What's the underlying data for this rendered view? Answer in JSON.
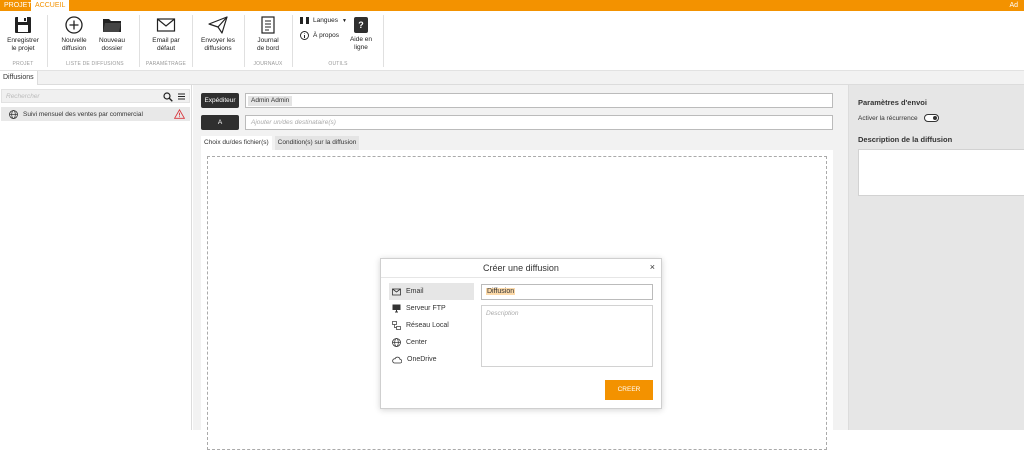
{
  "tabs": {
    "projet": "PROJET",
    "accueil": "ACCUEIL",
    "user": "Ad"
  },
  "ribbon": {
    "save": "Enregistrer\nle projet",
    "new_diffusion": "Nouvelle\ndiffusion",
    "new_folder": "Nouveau\ndossier",
    "email_default": "Email par\ndéfaut",
    "send": "Envoyer les\ndiffusions",
    "journal": "Journal\nde bord",
    "langues": "Langues",
    "apropos": "À propos",
    "help": "Aide en\nligne",
    "help_glyph": "?",
    "groups": {
      "projet": "PROJET",
      "liste": "LISTE DE DIFFUSIONS",
      "param": "PARAMÉTRAGE",
      "journaux": "JOURNAUX",
      "outils": "OUTILS"
    }
  },
  "diffusions_tab": "Diffusions",
  "left": {
    "search_placeholder": "Rechercher",
    "items": [
      {
        "label": "Suivi mensuel des ventes par commercial"
      }
    ]
  },
  "main": {
    "expediteur_btn": "Expéditeur",
    "expediteur_value": "Admin Admin",
    "a_btn": "A",
    "dest_placeholder": "Ajouter un/des destinataire(s)",
    "subtabs": [
      "Choix du/des fichier(s)",
      "Condition(s) sur la diffusion"
    ]
  },
  "right": {
    "params_title": "Paramètres d'envoi",
    "recurrence_label": "Activer la récurrence",
    "desc_title": "Description de la diffusion"
  },
  "modal": {
    "title": "Créer une diffusion",
    "close": "×",
    "types": [
      "Email",
      "Serveur FTP",
      "Réseau Local",
      "Center",
      "OneDrive"
    ],
    "name_value": "Diffusion",
    "desc_placeholder": "Description",
    "create_label": "CREER"
  },
  "colors": {
    "accent": "#f39200",
    "dark_button": "#2f2f2f",
    "panel_bg": "#f2f2f2"
  }
}
